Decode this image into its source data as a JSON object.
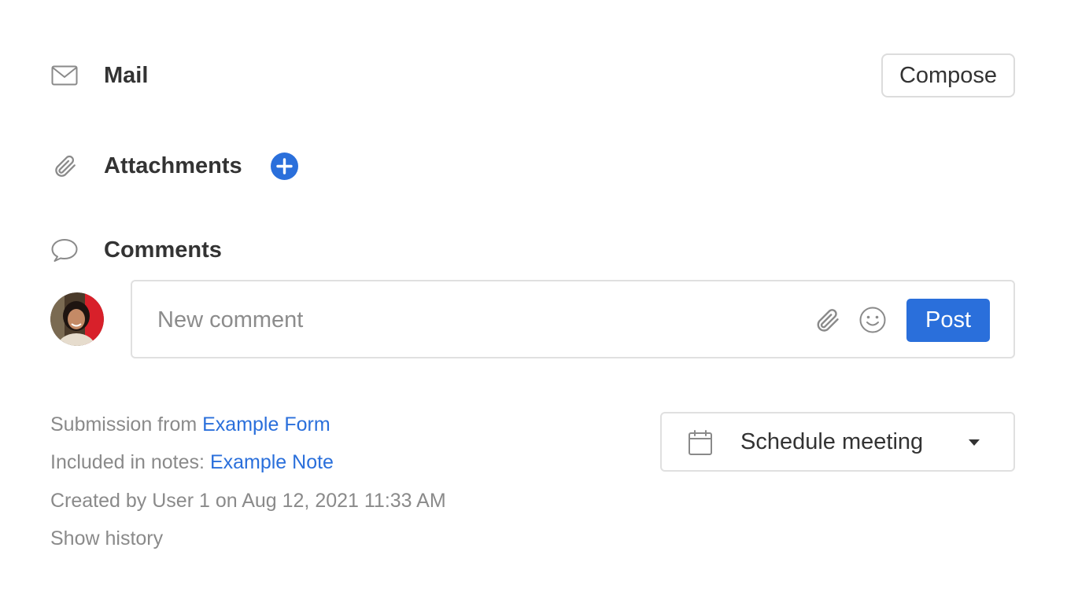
{
  "mail": {
    "icon": "envelope-icon",
    "title": "Mail",
    "compose_label": "Compose"
  },
  "attachments": {
    "icon": "paperclip-icon",
    "title": "Attachments",
    "add_icon": "plus-circle-icon"
  },
  "comments": {
    "icon": "speech-bubble-icon",
    "title": "Comments",
    "input_placeholder": "New comment",
    "input_value": "",
    "attach_icon": "paperclip-icon",
    "emoji_icon": "smiley-icon",
    "post_label": "Post"
  },
  "meta": {
    "submission_prefix": "Submission from",
    "submission_link": "Example Form",
    "notes_prefix": "Included in notes:",
    "notes_link": "Example Note",
    "created": "Created by User 1 on Aug 12, 2021 11:33 AM",
    "show_history": "Show history"
  },
  "schedule": {
    "icon": "calendar-icon",
    "label": "Schedule meeting",
    "caret_icon": "caret-down-icon"
  },
  "colors": {
    "accent": "#2a6fdb",
    "text": "#333333",
    "muted": "#8a8a8a",
    "border": "#e0e0e0"
  }
}
